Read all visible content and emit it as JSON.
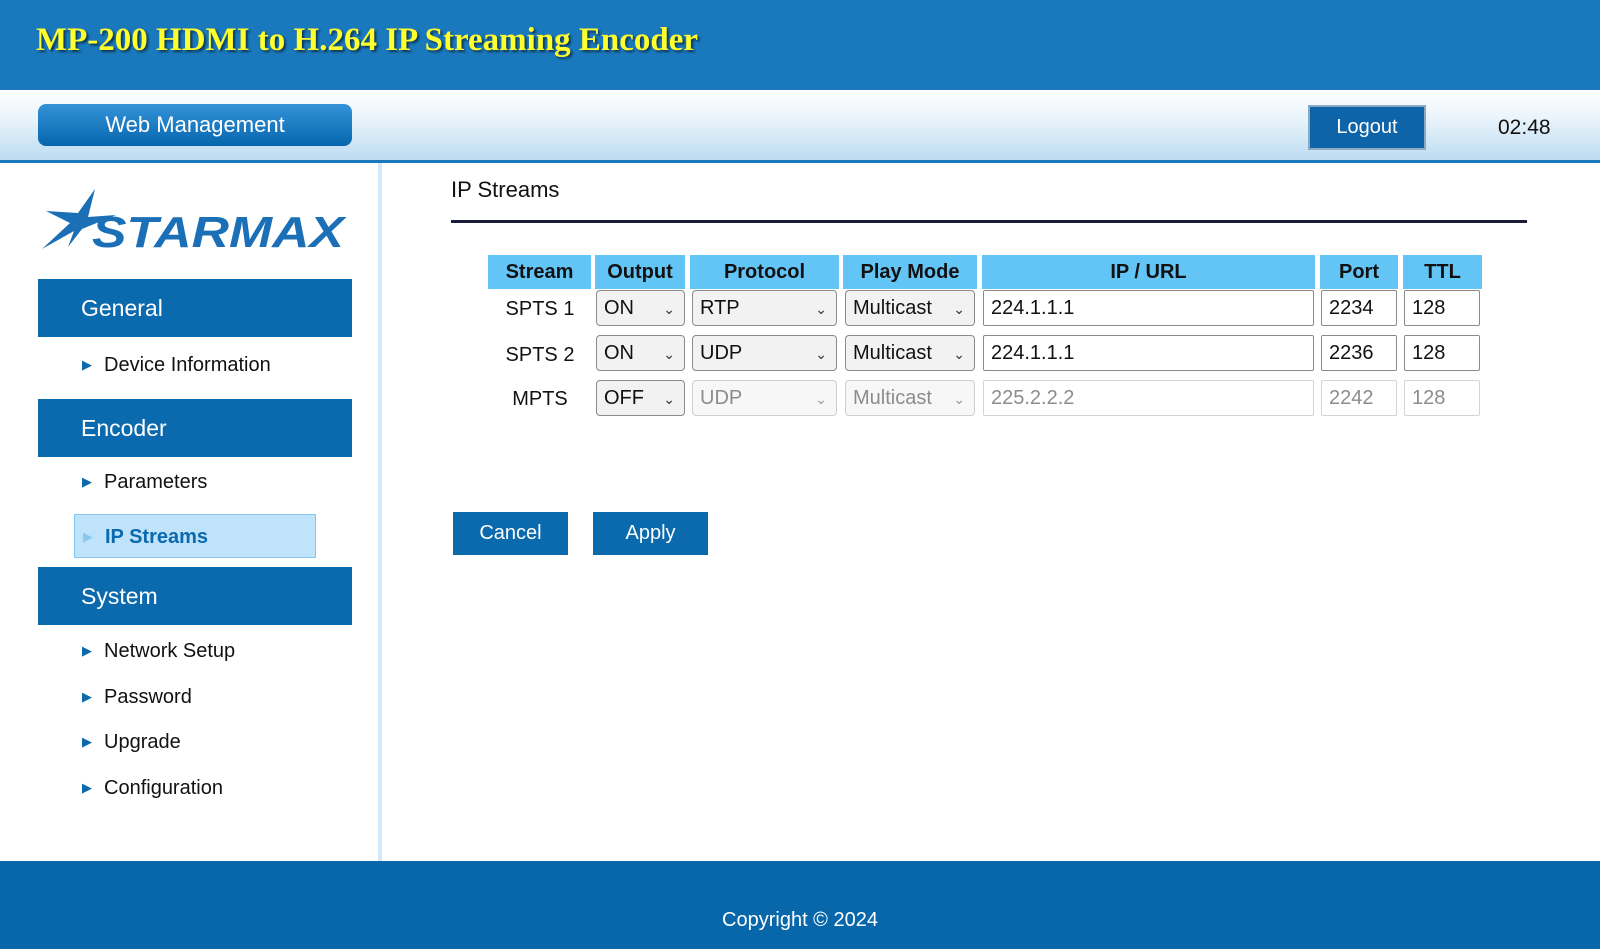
{
  "header": {
    "title": "MP-200 HDMI to H.264 IP Streaming Encoder",
    "tab_label": "Web Management",
    "logout_label": "Logout",
    "clock": "02:48"
  },
  "sidebar": {
    "logo_text": "STARMAX",
    "sections": [
      {
        "title": "General",
        "items": [
          {
            "label": "Device Information"
          }
        ]
      },
      {
        "title": "Encoder",
        "items": [
          {
            "label": "Parameters"
          },
          {
            "label": "IP Streams"
          }
        ]
      },
      {
        "title": "System",
        "items": [
          {
            "label": "Network Setup"
          },
          {
            "label": "Password"
          },
          {
            "label": "Upgrade"
          },
          {
            "label": "Configuration"
          }
        ]
      }
    ],
    "active_item": "IP Streams"
  },
  "content": {
    "title": "IP Streams",
    "columns": [
      "Stream",
      "Output",
      "Protocol",
      "Play Mode",
      "IP / URL",
      "Port",
      "TTL"
    ],
    "rows": [
      {
        "stream": "SPTS 1",
        "output": "ON",
        "protocol": "RTP",
        "play_mode": "Multicast",
        "ip": "224.1.1.1",
        "port": "2234",
        "ttl": "128",
        "enabled": true
      },
      {
        "stream": "SPTS 2",
        "output": "ON",
        "protocol": "UDP",
        "play_mode": "Multicast",
        "ip": "224.1.1.1",
        "port": "2236",
        "ttl": "128",
        "enabled": true
      },
      {
        "stream": "MPTS",
        "output": "OFF",
        "protocol": "UDP",
        "play_mode": "Multicast",
        "ip": "225.2.2.2",
        "port": "2242",
        "ttl": "128",
        "enabled": false
      }
    ],
    "cancel_label": "Cancel",
    "apply_label": "Apply"
  },
  "footer": {
    "copyright": "Copyright © 2024"
  },
  "colors": {
    "brand_blue": "#0b69ad",
    "header_blue": "#1a78bc",
    "title_yellow": "#ffff2e",
    "table_header": "#63c4f6",
    "active_nav_bg": "#bfe3fb"
  },
  "icons": {
    "nav_arrow": "triangle-right-icon",
    "select_chevron": "chevron-down-icon"
  }
}
